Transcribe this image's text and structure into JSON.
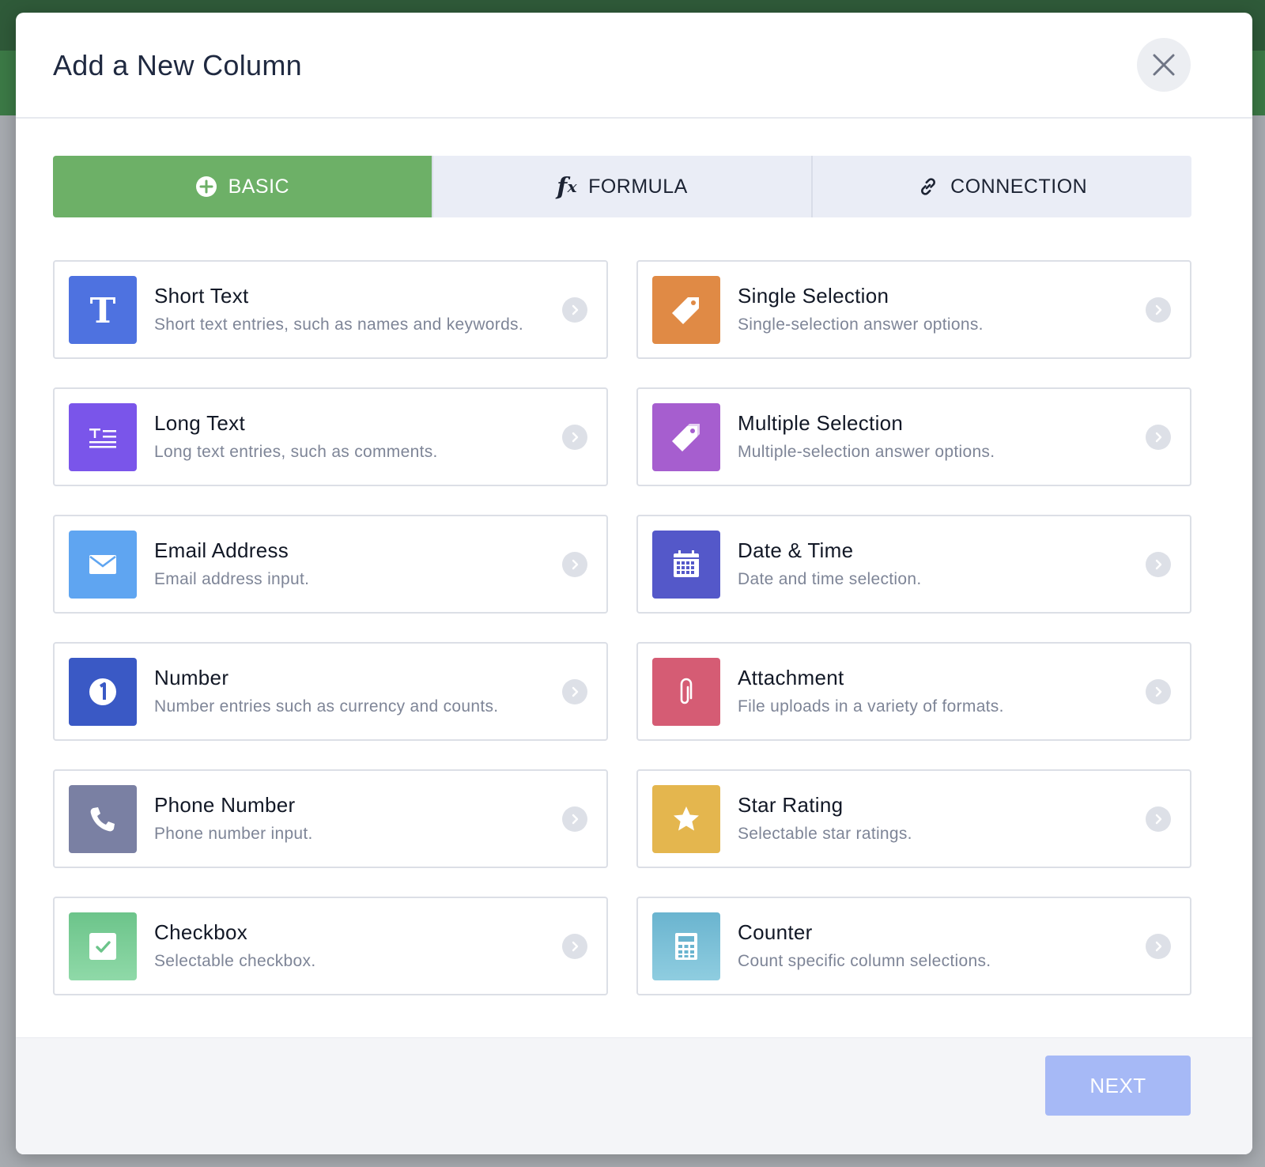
{
  "dialog": {
    "title": "Add a New Column",
    "close_icon": "close-icon"
  },
  "tabs": [
    {
      "label": "BASIC",
      "icon": "plus-circle-icon",
      "active": true
    },
    {
      "label": "FORMULA",
      "icon": "fx-icon",
      "icon_text": "f",
      "icon_sub": "x",
      "active": false
    },
    {
      "label": "CONNECTION",
      "icon": "link-icon",
      "active": false
    }
  ],
  "column_types": [
    {
      "title": "Short Text",
      "description": "Short text entries, such as names and keywords.",
      "icon": "text-t-icon",
      "color": "#4e72e0"
    },
    {
      "title": "Single Selection",
      "description": "Single-selection answer options.",
      "icon": "tag-icon",
      "color": "#e08a45"
    },
    {
      "title": "Long Text",
      "description": "Long text entries, such as comments.",
      "icon": "long-text-icon",
      "color": "#7a55ea"
    },
    {
      "title": "Multiple Selection",
      "description": "Multiple-selection answer options.",
      "icon": "tags-icon",
      "color": "#a65ecf"
    },
    {
      "title": "Email Address",
      "description": "Email address input.",
      "icon": "envelope-icon",
      "color": "#5fa5f1"
    },
    {
      "title": "Date & Time",
      "description": "Date and time selection.",
      "icon": "calendar-icon",
      "color": "#5458c9"
    },
    {
      "title": "Number",
      "description": "Number entries such as currency and counts.",
      "icon": "number-one-icon",
      "color": "#3a59c5"
    },
    {
      "title": "Attachment",
      "description": "File uploads in a variety of formats.",
      "icon": "paperclip-icon",
      "color": "#d55c74"
    },
    {
      "title": "Phone Number",
      "description": "Phone number input.",
      "icon": "phone-icon",
      "color": "#7a80a3"
    },
    {
      "title": "Star Rating",
      "description": "Selectable star ratings.",
      "icon": "star-icon",
      "color": "#e4b64e"
    },
    {
      "title": "Checkbox",
      "description": "Selectable checkbox.",
      "icon": "checkbox-icon",
      "color": "#6cc48a"
    },
    {
      "title": "Counter",
      "description": "Count specific column selections.",
      "icon": "calculator-icon",
      "color": "#6ab4cf"
    }
  ],
  "footer": {
    "next_label": "NEXT",
    "next_color": "#a6b9f6"
  },
  "accent": {
    "active_tab": "#6db067"
  }
}
